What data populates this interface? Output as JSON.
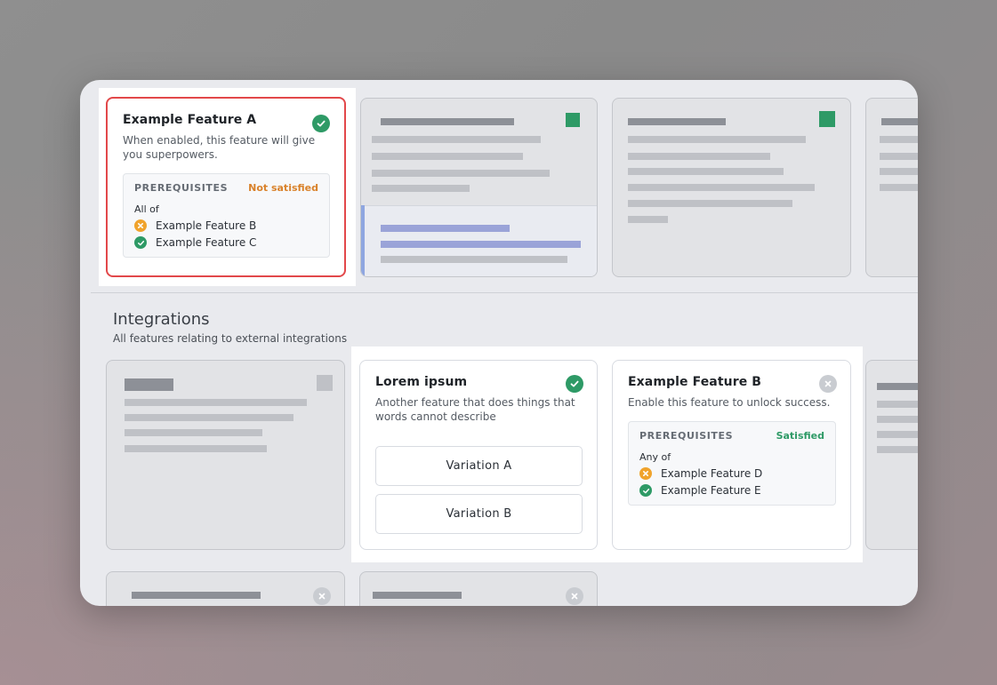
{
  "card_a": {
    "title": "Example Feature A",
    "description": "When enabled, this feature will give you superpowers.",
    "prereq_label": "PREREQUISITES",
    "prereq_state": "Not satisfied",
    "prereq_mode": "All of",
    "items": [
      {
        "label": "Example Feature B",
        "status": "warn"
      },
      {
        "label": "Example Feature C",
        "status": "ok"
      }
    ]
  },
  "section": {
    "title": "Integrations",
    "subtitle": "All features relating to external integrations"
  },
  "card_lorem": {
    "title": "Lorem ipsum",
    "description": "Another feature that does things that words cannot describe",
    "variations": [
      "Variation A",
      "Variation B"
    ]
  },
  "card_b": {
    "title": "Example Feature B",
    "description": "Enable this feature to unlock success.",
    "prereq_label": "PREREQUISITES",
    "prereq_state": "Satisfied",
    "prereq_mode": "Any of",
    "items": [
      {
        "label": "Example Feature D",
        "status": "warn"
      },
      {
        "label": "Example Feature E",
        "status": "ok"
      }
    ]
  },
  "colors": {
    "ok": "#2e9a66",
    "warn": "#f0a32c",
    "error_border": "#e2484a",
    "not_satisfied": "#d9822b"
  }
}
